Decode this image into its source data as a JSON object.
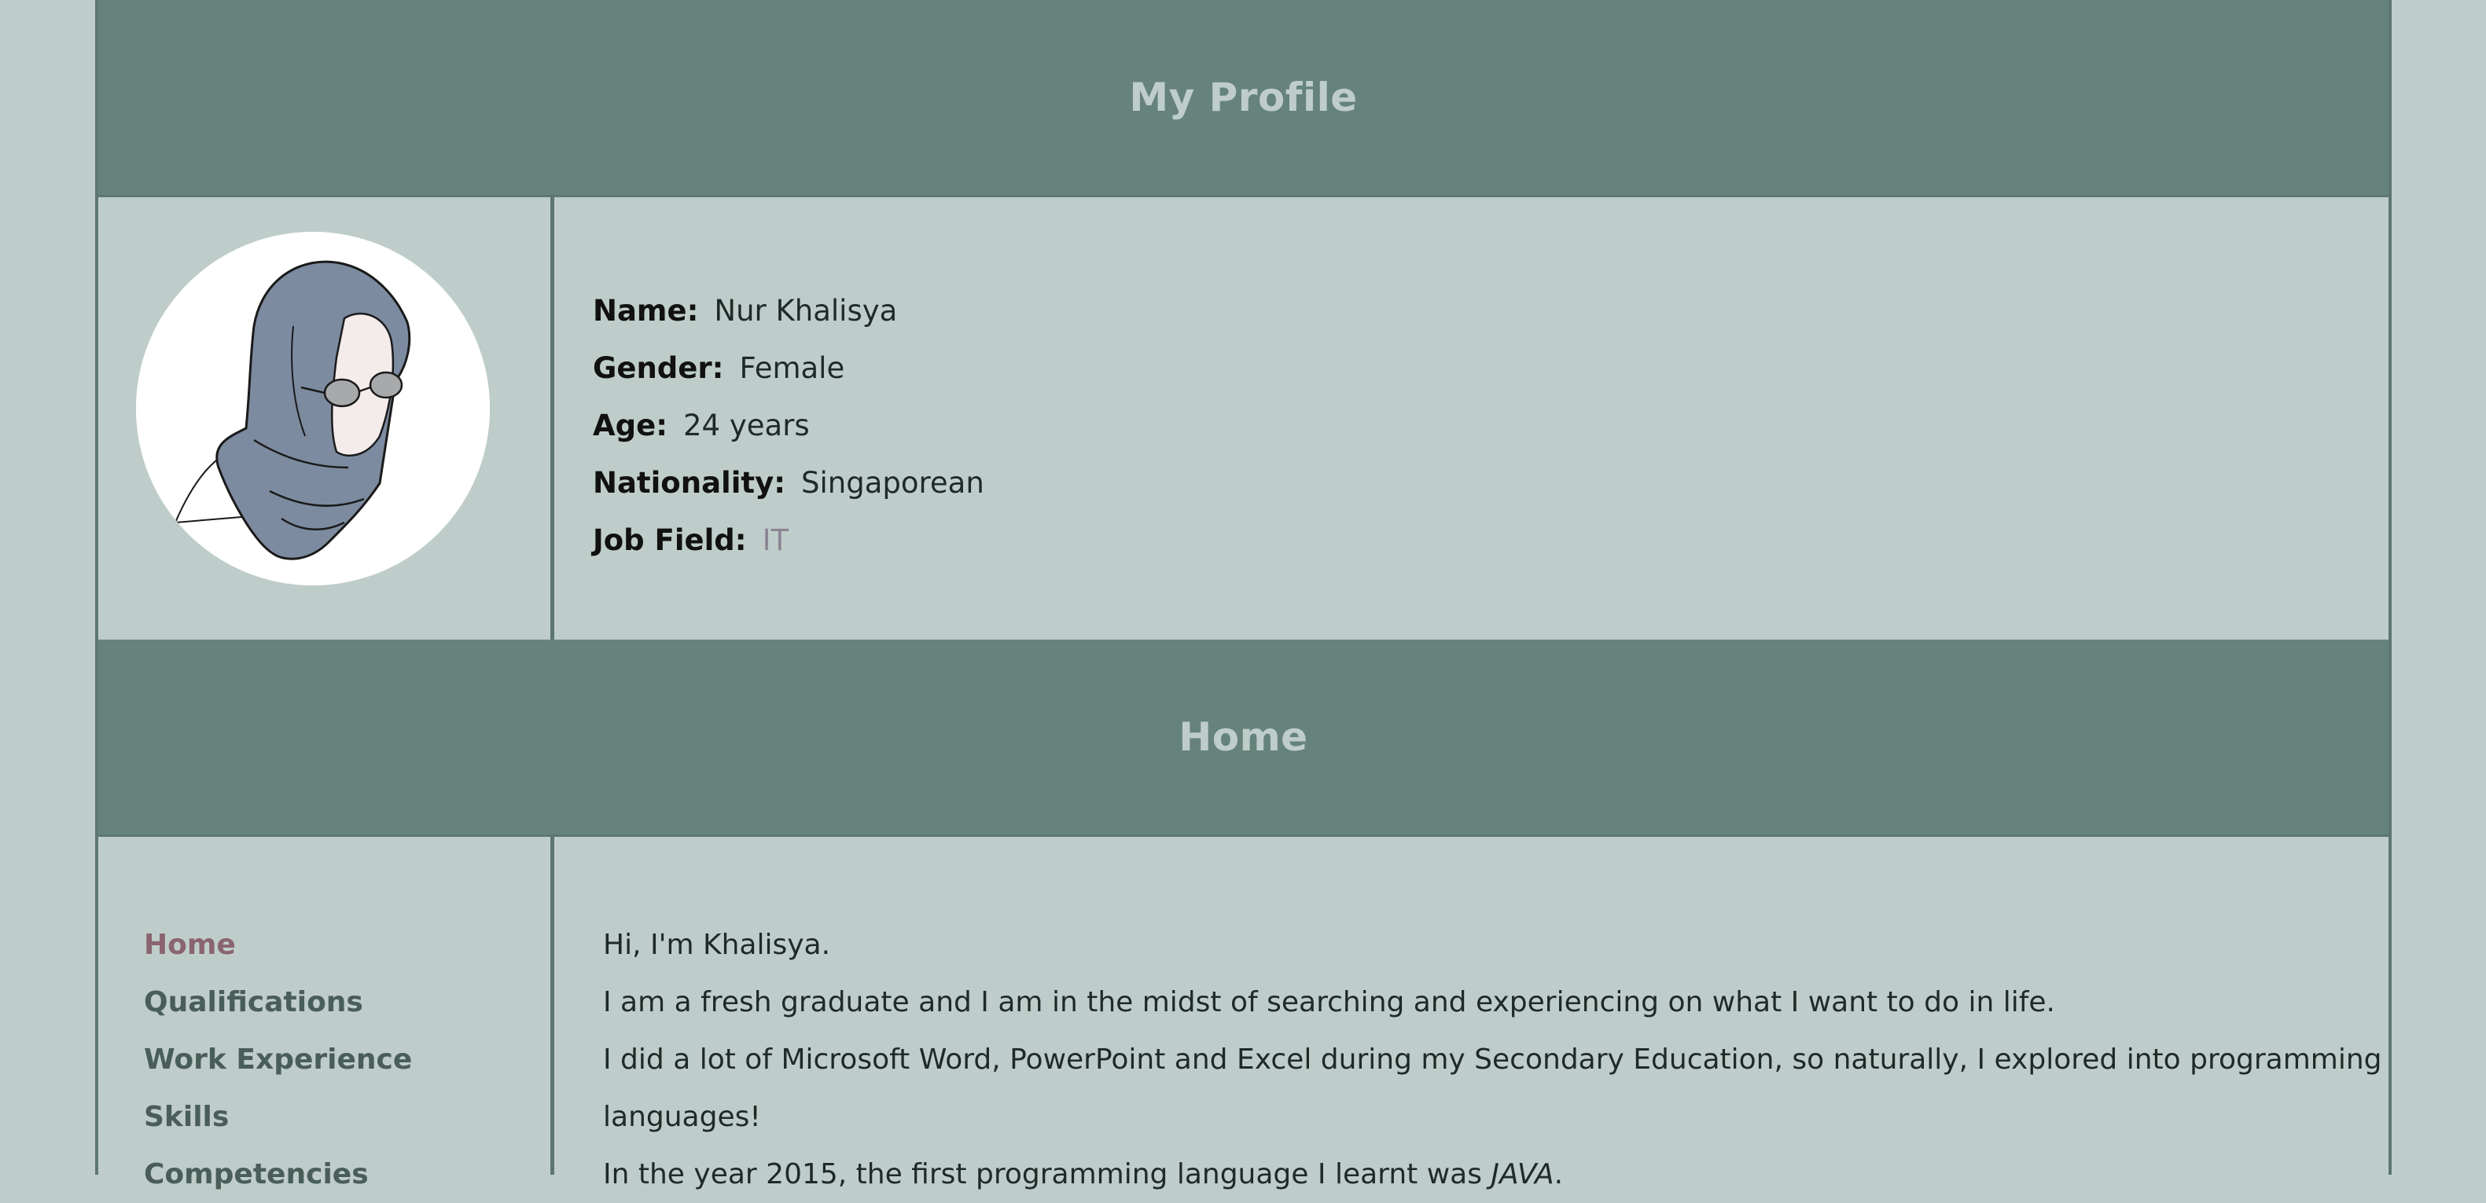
{
  "header": {
    "title": "My Profile"
  },
  "profile": {
    "avatar_icon": "hijab-woman-illustration",
    "fields": [
      {
        "label": "Name:",
        "value": "Nur Khalisya"
      },
      {
        "label": "Gender:",
        "value": "Female"
      },
      {
        "label": "Age:",
        "value": "24 years"
      },
      {
        "label": "Nationality:",
        "value": "Singaporean"
      },
      {
        "label": "Job Field:",
        "value": "IT"
      }
    ]
  },
  "section": {
    "title": "Home"
  },
  "nav": {
    "items": [
      {
        "label": "Home",
        "active": true
      },
      {
        "label": "Qualifications"
      },
      {
        "label": "Work Experience"
      },
      {
        "label": "Skills"
      },
      {
        "label": "Competencies"
      }
    ]
  },
  "content": {
    "lines": [
      "Hi, I'm Khalisya.",
      "I am a fresh graduate and I am in the midst of searching and experiencing on what I want to do in life.",
      "I did a lot of Microsoft Word, PowerPoint and Excel during my Secondary Education, so naturally, I explored into programming",
      "languages!"
    ],
    "last_line_prefix": "In the year 2015, the first programming language I learnt was ",
    "last_line_em": "JAVA",
    "last_line_suffix": "."
  },
  "colors": {
    "background": "#bfcdca",
    "banner": "#66837b",
    "border": "#5d7770",
    "nav_active": "#8a6470",
    "nav_inactive": "#4a5e59"
  }
}
